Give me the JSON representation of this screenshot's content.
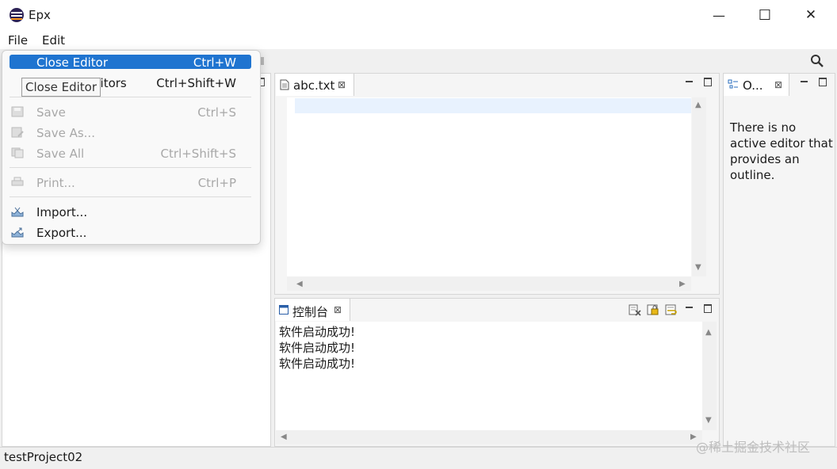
{
  "window": {
    "title": "Epx",
    "minimize_glyph": "—",
    "maximize_glyph": "☐",
    "close_glyph": "✕"
  },
  "menubar": {
    "items": [
      "File",
      "Edit"
    ]
  },
  "file_menu": {
    "highlighted": {
      "label": "Close Editor",
      "shortcut": "Ctrl+W"
    },
    "close_all": {
      "label_partial": "ditors",
      "shortcut": "Ctrl+Shift+W"
    },
    "tooltip": "Close Editor",
    "save": {
      "label": "Save",
      "shortcut": "Ctrl+S"
    },
    "save_as": {
      "label": "Save As..."
    },
    "save_all": {
      "label": "Save All",
      "shortcut": "Ctrl+Shift+S"
    },
    "print": {
      "label": "Print...",
      "shortcut": "Ctrl+P"
    },
    "import": {
      "label": "Import..."
    },
    "export": {
      "label": "Export..."
    }
  },
  "editor": {
    "tab_label": "abc.txt"
  },
  "outline": {
    "tab_label": "O...",
    "message": "There is no active editor that provides an outline."
  },
  "console": {
    "tab_label": "控制台",
    "lines": [
      "软件启动成功!",
      "软件启动成功!",
      "软件启动成功!"
    ]
  },
  "status": {
    "text": "testProject02"
  },
  "watermark": "@稀土掘金技术社区",
  "icons": {
    "close_tab": "⊠",
    "scroll_up": "▲",
    "scroll_down": "▼",
    "scroll_left": "◀",
    "scroll_right": "▶"
  },
  "colors": {
    "menu_highlight": "#1f74d0",
    "editor_current_line": "#e8f2fe",
    "app_logo": "#2c2255"
  }
}
